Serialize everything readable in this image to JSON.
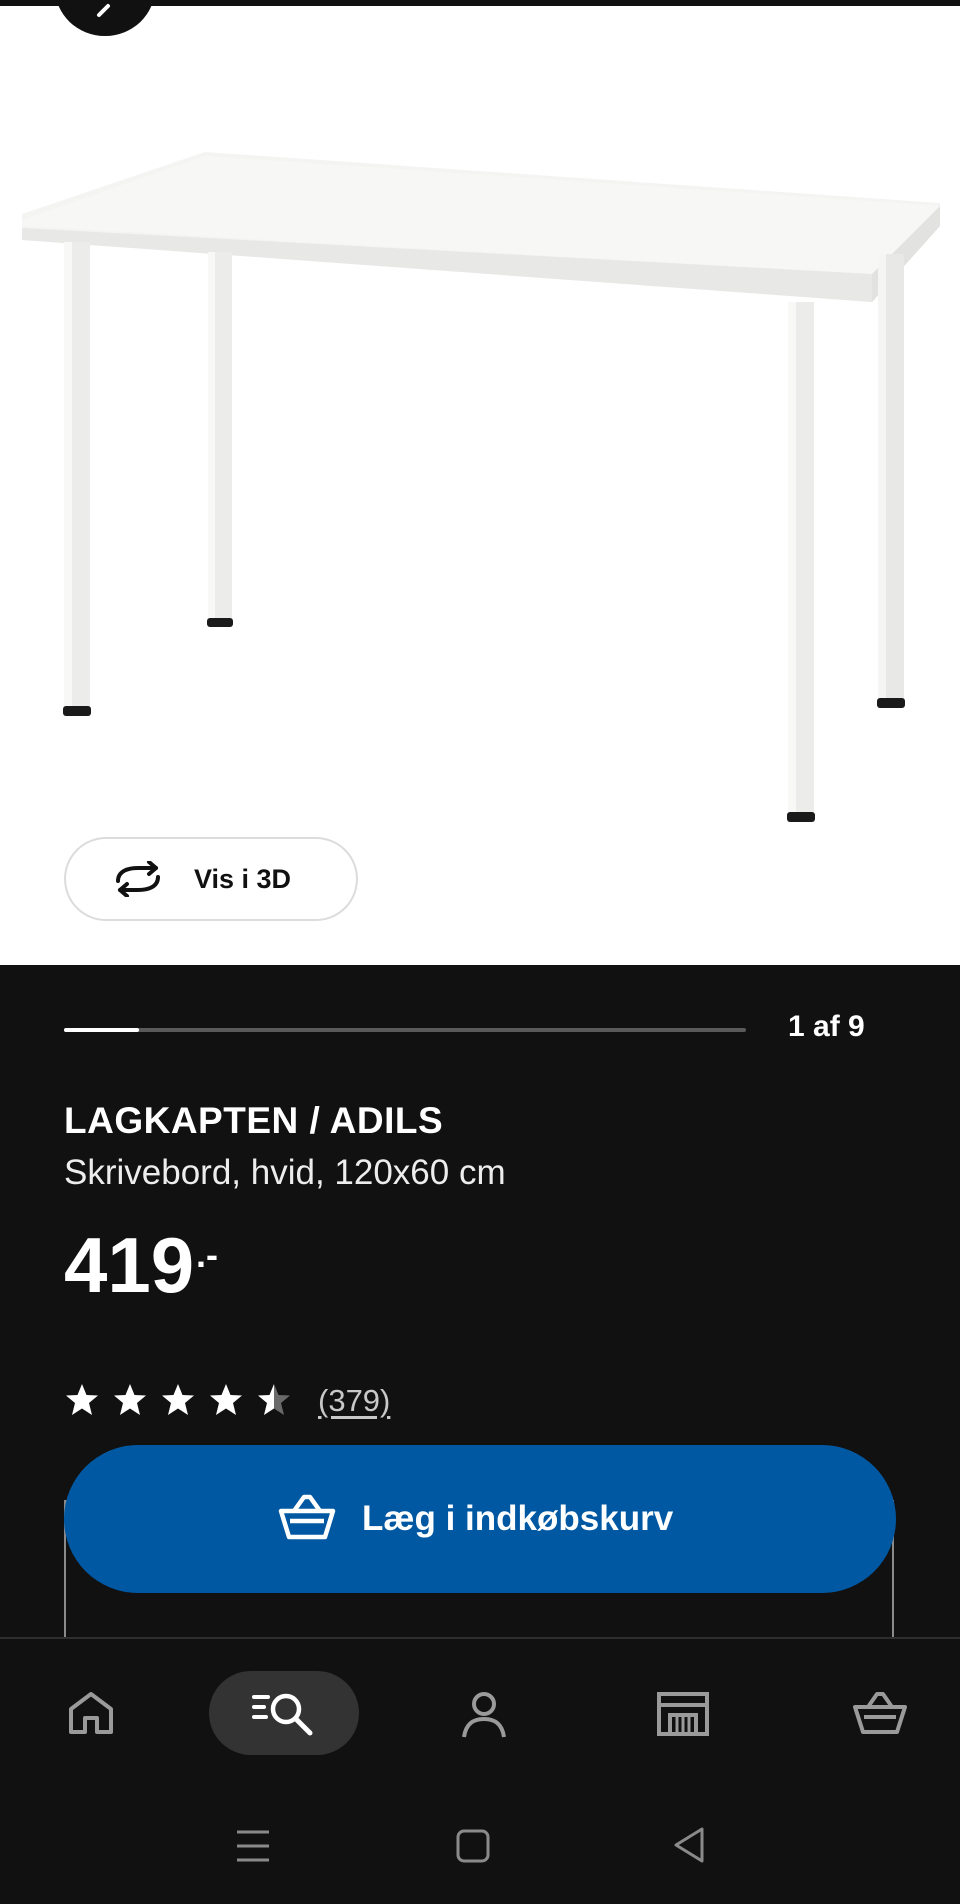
{
  "gallery": {
    "view_3d_label": "Vis i 3D",
    "position_text": "1 af 9",
    "progress_fraction": 0.11
  },
  "product": {
    "name": "LAGKAPTEN / ADILS",
    "description": "Skrivebord, hvid, 120x60 cm",
    "price": "419",
    "price_suffix": ".-",
    "rating": 4.5,
    "review_count": "(379)"
  },
  "actions": {
    "add_to_cart_label": "Læg i indkøbskurv"
  },
  "bottom_nav": {
    "items": [
      "home-icon",
      "search-icon",
      "profile-icon",
      "store-icon",
      "cart-icon"
    ],
    "active": "search-icon"
  },
  "colors": {
    "primary_button": "#0058a3",
    "background_dark": "#111111",
    "active_nav_pill": "#333333"
  }
}
